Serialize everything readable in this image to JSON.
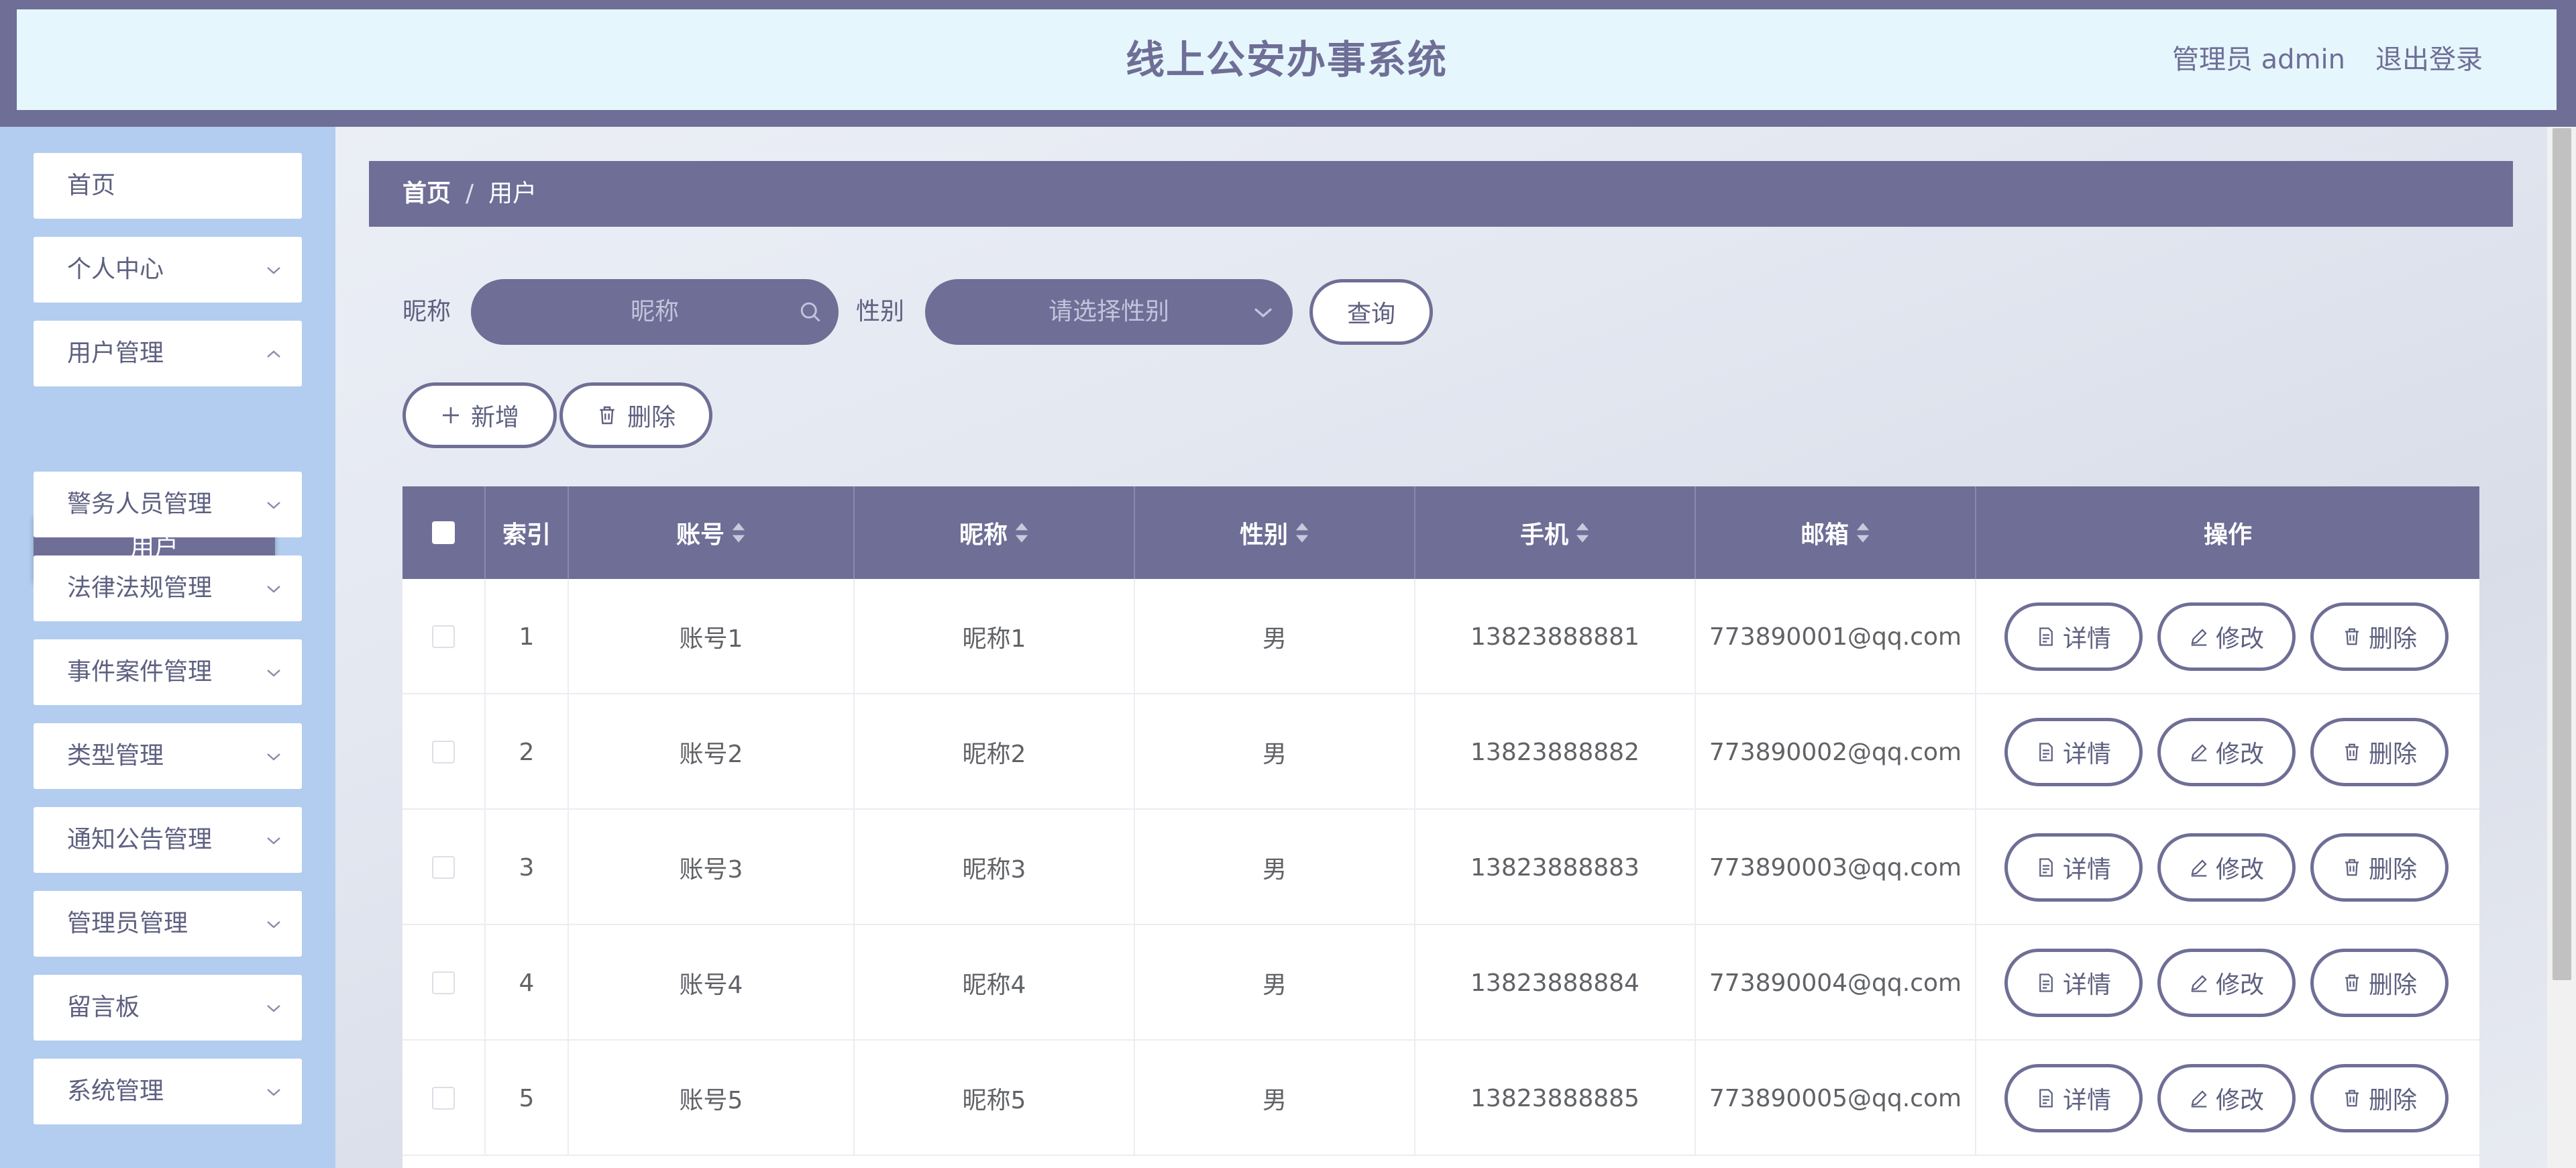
{
  "header": {
    "title": "线上公安办事系统",
    "user": "管理员 admin",
    "logout": "退出登录"
  },
  "sidebar": {
    "items": [
      {
        "label": "首页"
      },
      {
        "label": "个人中心"
      },
      {
        "label": "用户管理"
      },
      {
        "label": "警务人员管理"
      },
      {
        "label": "法律法规管理"
      },
      {
        "label": "事件案件管理"
      },
      {
        "label": "类型管理"
      },
      {
        "label": "通知公告管理"
      },
      {
        "label": "管理员管理"
      },
      {
        "label": "留言板"
      },
      {
        "label": "系统管理"
      }
    ],
    "active_sub": "用户"
  },
  "breadcrumb": {
    "home": "首页",
    "sep": "/",
    "current": "用户"
  },
  "search": {
    "nickname_label": "昵称",
    "nickname_placeholder": "昵称",
    "gender_label": "性别",
    "gender_placeholder": "请选择性别",
    "query_button": "查询"
  },
  "actions": {
    "add": "新增",
    "delete": "删除"
  },
  "table": {
    "headers": [
      "索引",
      "账号",
      "昵称",
      "性别",
      "手机",
      "邮箱",
      "操作"
    ],
    "row_buttons": {
      "detail": "详情",
      "edit": "修改",
      "delete": "删除"
    },
    "rows": [
      {
        "index": "1",
        "account": "账号1",
        "nickname": "昵称1",
        "gender": "男",
        "phone": "13823888881",
        "email": "773890001@qq.com"
      },
      {
        "index": "2",
        "account": "账号2",
        "nickname": "昵称2",
        "gender": "男",
        "phone": "13823888882",
        "email": "773890002@qq.com"
      },
      {
        "index": "3",
        "account": "账号3",
        "nickname": "昵称3",
        "gender": "男",
        "phone": "13823888883",
        "email": "773890003@qq.com"
      },
      {
        "index": "4",
        "account": "账号4",
        "nickname": "昵称4",
        "gender": "男",
        "phone": "13823888884",
        "email": "773890004@qq.com"
      },
      {
        "index": "5",
        "account": "账号5",
        "nickname": "昵称5",
        "gender": "男",
        "phone": "13823888885",
        "email": "773890005@qq.com"
      }
    ]
  },
  "colors": {
    "primary": "#6e6e96",
    "sidebar_bg": "#b2cdef",
    "header_inner": "#e6f6fd"
  }
}
